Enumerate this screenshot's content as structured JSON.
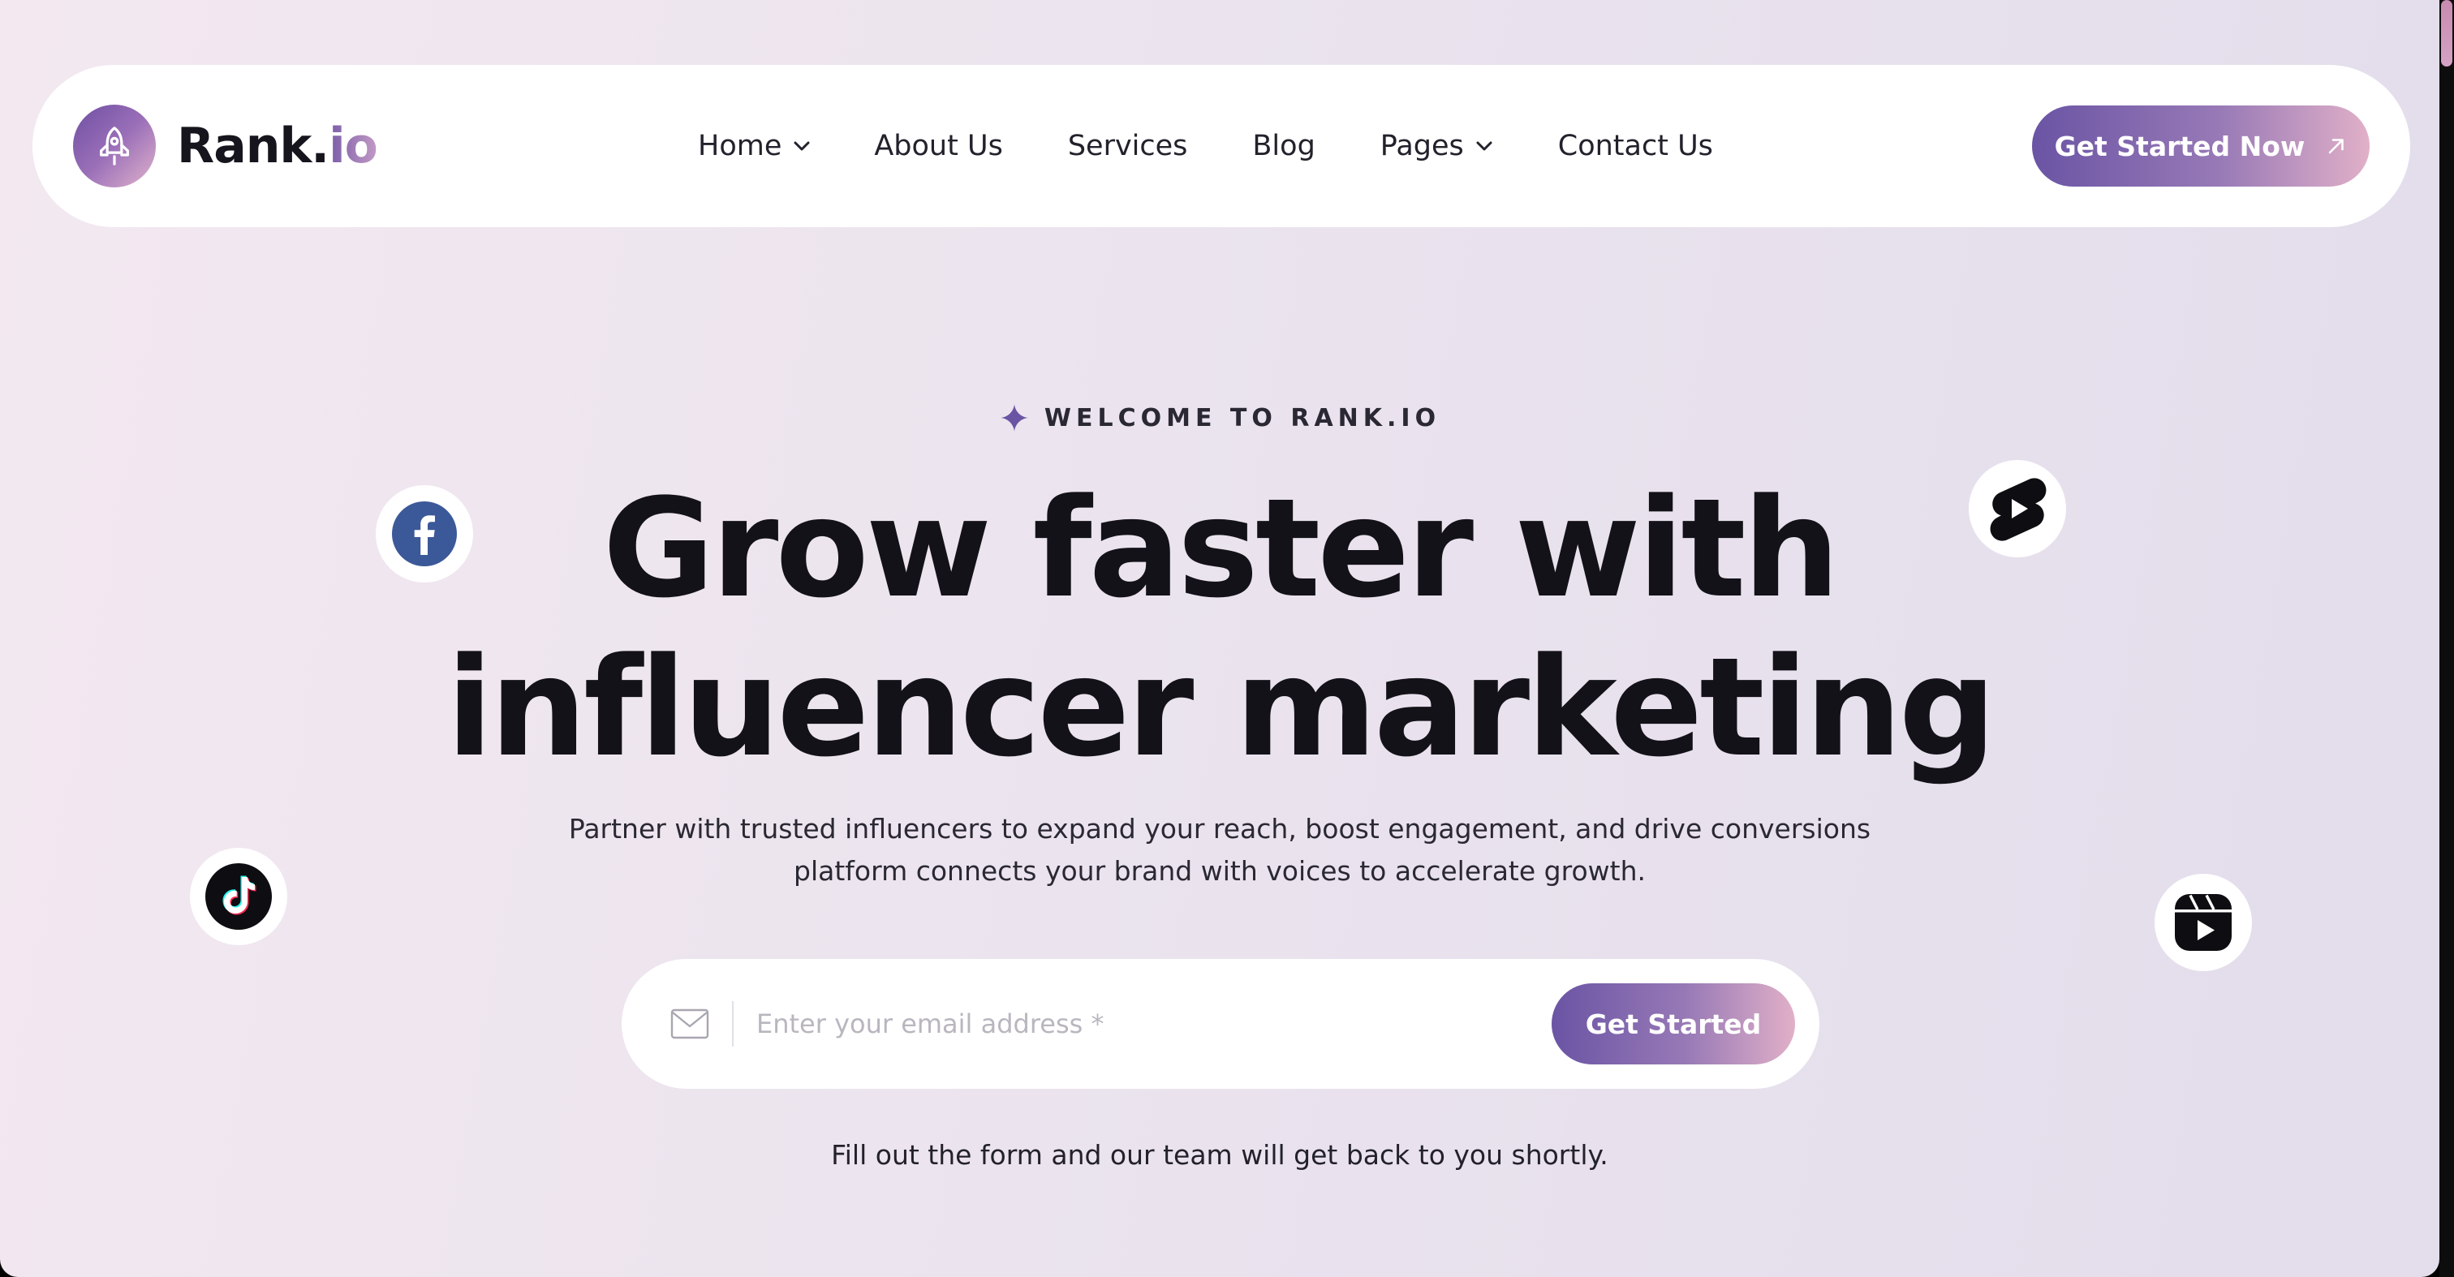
{
  "brand": {
    "name_main": "Rank.",
    "name_accent": "io",
    "logo_icon": "rocket-icon"
  },
  "nav": {
    "items": [
      {
        "label": "Home",
        "has_dropdown": true
      },
      {
        "label": "About Us",
        "has_dropdown": false
      },
      {
        "label": "Services",
        "has_dropdown": false
      },
      {
        "label": "Blog",
        "has_dropdown": false
      },
      {
        "label": "Pages",
        "has_dropdown": true
      },
      {
        "label": "Contact Us",
        "has_dropdown": false
      }
    ],
    "cta_label": "Get Started Now",
    "cta_icon": "arrow-up-right-icon"
  },
  "hero": {
    "eyebrow": "WELCOME TO RANK.IO",
    "eyebrow_icon": "sparkle-icon",
    "headline_line1": "Grow faster with",
    "headline_line2": "influencer marketing",
    "subtitle_line1": "Partner with trusted influencers to expand your reach, boost engagement, and drive conversions",
    "subtitle_line2": "platform connects your brand with voices to accelerate growth."
  },
  "form": {
    "email_placeholder": "Enter your email address *",
    "email_value": "",
    "submit_label": "Get Started",
    "note": "Fill out the form and our team will get back to you shortly."
  },
  "social_icons": [
    "facebook-icon",
    "youtube-shorts-icon",
    "tiktok-icon",
    "instagram-reels-icon"
  ],
  "colors": {
    "brand_purple": "#6a54a4",
    "brand_pink": "#e1b0c8",
    "heading": "#141219",
    "facebook_blue": "#3b5998"
  }
}
